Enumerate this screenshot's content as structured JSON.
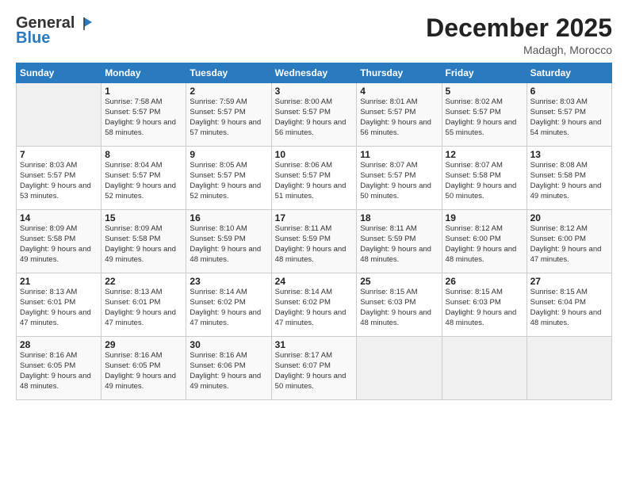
{
  "logo": {
    "general": "General",
    "blue": "Blue",
    "tagline": ""
  },
  "header": {
    "title": "December 2025",
    "location": "Madagh, Morocco"
  },
  "weekdays": [
    "Sunday",
    "Monday",
    "Tuesday",
    "Wednesday",
    "Thursday",
    "Friday",
    "Saturday"
  ],
  "weeks": [
    [
      {
        "day": "",
        "sunrise": "",
        "sunset": "",
        "daylight": ""
      },
      {
        "day": "1",
        "sunrise": "Sunrise: 7:58 AM",
        "sunset": "Sunset: 5:57 PM",
        "daylight": "Daylight: 9 hours and 58 minutes."
      },
      {
        "day": "2",
        "sunrise": "Sunrise: 7:59 AM",
        "sunset": "Sunset: 5:57 PM",
        "daylight": "Daylight: 9 hours and 57 minutes."
      },
      {
        "day": "3",
        "sunrise": "Sunrise: 8:00 AM",
        "sunset": "Sunset: 5:57 PM",
        "daylight": "Daylight: 9 hours and 56 minutes."
      },
      {
        "day": "4",
        "sunrise": "Sunrise: 8:01 AM",
        "sunset": "Sunset: 5:57 PM",
        "daylight": "Daylight: 9 hours and 56 minutes."
      },
      {
        "day": "5",
        "sunrise": "Sunrise: 8:02 AM",
        "sunset": "Sunset: 5:57 PM",
        "daylight": "Daylight: 9 hours and 55 minutes."
      },
      {
        "day": "6",
        "sunrise": "Sunrise: 8:03 AM",
        "sunset": "Sunset: 5:57 PM",
        "daylight": "Daylight: 9 hours and 54 minutes."
      }
    ],
    [
      {
        "day": "7",
        "sunrise": "Sunrise: 8:03 AM",
        "sunset": "Sunset: 5:57 PM",
        "daylight": "Daylight: 9 hours and 53 minutes."
      },
      {
        "day": "8",
        "sunrise": "Sunrise: 8:04 AM",
        "sunset": "Sunset: 5:57 PM",
        "daylight": "Daylight: 9 hours and 52 minutes."
      },
      {
        "day": "9",
        "sunrise": "Sunrise: 8:05 AM",
        "sunset": "Sunset: 5:57 PM",
        "daylight": "Daylight: 9 hours and 52 minutes."
      },
      {
        "day": "10",
        "sunrise": "Sunrise: 8:06 AM",
        "sunset": "Sunset: 5:57 PM",
        "daylight": "Daylight: 9 hours and 51 minutes."
      },
      {
        "day": "11",
        "sunrise": "Sunrise: 8:07 AM",
        "sunset": "Sunset: 5:57 PM",
        "daylight": "Daylight: 9 hours and 50 minutes."
      },
      {
        "day": "12",
        "sunrise": "Sunrise: 8:07 AM",
        "sunset": "Sunset: 5:58 PM",
        "daylight": "Daylight: 9 hours and 50 minutes."
      },
      {
        "day": "13",
        "sunrise": "Sunrise: 8:08 AM",
        "sunset": "Sunset: 5:58 PM",
        "daylight": "Daylight: 9 hours and 49 minutes."
      }
    ],
    [
      {
        "day": "14",
        "sunrise": "Sunrise: 8:09 AM",
        "sunset": "Sunset: 5:58 PM",
        "daylight": "Daylight: 9 hours and 49 minutes."
      },
      {
        "day": "15",
        "sunrise": "Sunrise: 8:09 AM",
        "sunset": "Sunset: 5:58 PM",
        "daylight": "Daylight: 9 hours and 49 minutes."
      },
      {
        "day": "16",
        "sunrise": "Sunrise: 8:10 AM",
        "sunset": "Sunset: 5:59 PM",
        "daylight": "Daylight: 9 hours and 48 minutes."
      },
      {
        "day": "17",
        "sunrise": "Sunrise: 8:11 AM",
        "sunset": "Sunset: 5:59 PM",
        "daylight": "Daylight: 9 hours and 48 minutes."
      },
      {
        "day": "18",
        "sunrise": "Sunrise: 8:11 AM",
        "sunset": "Sunset: 5:59 PM",
        "daylight": "Daylight: 9 hours and 48 minutes."
      },
      {
        "day": "19",
        "sunrise": "Sunrise: 8:12 AM",
        "sunset": "Sunset: 6:00 PM",
        "daylight": "Daylight: 9 hours and 48 minutes."
      },
      {
        "day": "20",
        "sunrise": "Sunrise: 8:12 AM",
        "sunset": "Sunset: 6:00 PM",
        "daylight": "Daylight: 9 hours and 47 minutes."
      }
    ],
    [
      {
        "day": "21",
        "sunrise": "Sunrise: 8:13 AM",
        "sunset": "Sunset: 6:01 PM",
        "daylight": "Daylight: 9 hours and 47 minutes."
      },
      {
        "day": "22",
        "sunrise": "Sunrise: 8:13 AM",
        "sunset": "Sunset: 6:01 PM",
        "daylight": "Daylight: 9 hours and 47 minutes."
      },
      {
        "day": "23",
        "sunrise": "Sunrise: 8:14 AM",
        "sunset": "Sunset: 6:02 PM",
        "daylight": "Daylight: 9 hours and 47 minutes."
      },
      {
        "day": "24",
        "sunrise": "Sunrise: 8:14 AM",
        "sunset": "Sunset: 6:02 PM",
        "daylight": "Daylight: 9 hours and 47 minutes."
      },
      {
        "day": "25",
        "sunrise": "Sunrise: 8:15 AM",
        "sunset": "Sunset: 6:03 PM",
        "daylight": "Daylight: 9 hours and 48 minutes."
      },
      {
        "day": "26",
        "sunrise": "Sunrise: 8:15 AM",
        "sunset": "Sunset: 6:03 PM",
        "daylight": "Daylight: 9 hours and 48 minutes."
      },
      {
        "day": "27",
        "sunrise": "Sunrise: 8:15 AM",
        "sunset": "Sunset: 6:04 PM",
        "daylight": "Daylight: 9 hours and 48 minutes."
      }
    ],
    [
      {
        "day": "28",
        "sunrise": "Sunrise: 8:16 AM",
        "sunset": "Sunset: 6:05 PM",
        "daylight": "Daylight: 9 hours and 48 minutes."
      },
      {
        "day": "29",
        "sunrise": "Sunrise: 8:16 AM",
        "sunset": "Sunset: 6:05 PM",
        "daylight": "Daylight: 9 hours and 49 minutes."
      },
      {
        "day": "30",
        "sunrise": "Sunrise: 8:16 AM",
        "sunset": "Sunset: 6:06 PM",
        "daylight": "Daylight: 9 hours and 49 minutes."
      },
      {
        "day": "31",
        "sunrise": "Sunrise: 8:17 AM",
        "sunset": "Sunset: 6:07 PM",
        "daylight": "Daylight: 9 hours and 50 minutes."
      },
      {
        "day": "",
        "sunrise": "",
        "sunset": "",
        "daylight": ""
      },
      {
        "day": "",
        "sunrise": "",
        "sunset": "",
        "daylight": ""
      },
      {
        "day": "",
        "sunrise": "",
        "sunset": "",
        "daylight": ""
      }
    ]
  ]
}
